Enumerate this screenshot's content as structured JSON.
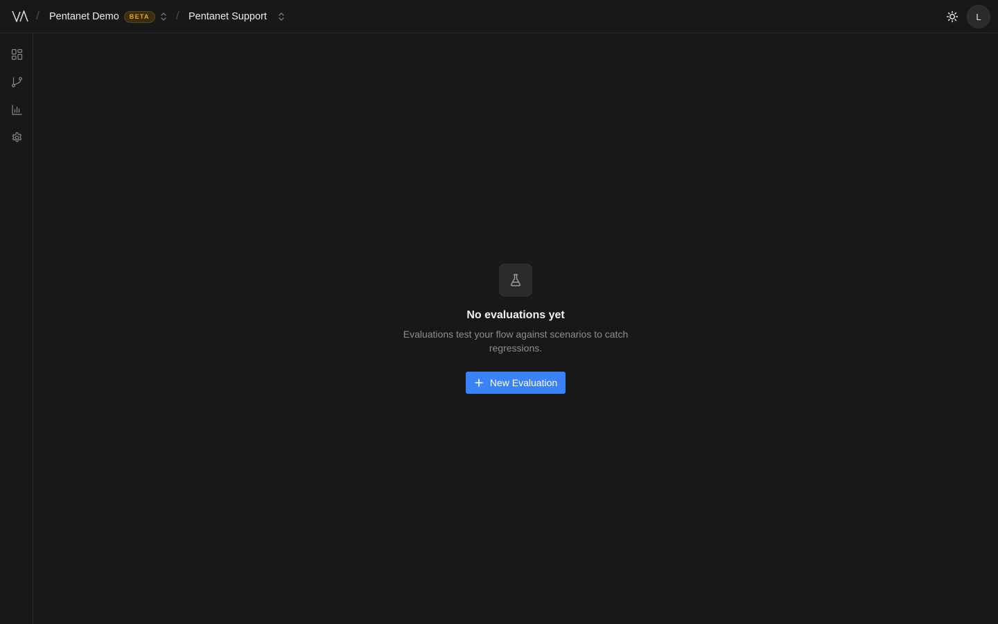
{
  "header": {
    "logo_icon": "va-logo-icon",
    "workspace": {
      "name": "Pentanet Demo",
      "badge": "BETA"
    },
    "project": {
      "name": "Pentanet Support"
    },
    "separator": "/",
    "theme_icon": "sun-icon",
    "avatar_initial": "L"
  },
  "sidebar": {
    "items": [
      {
        "icon": "dashboard-icon"
      },
      {
        "icon": "flow-branch-icon"
      },
      {
        "icon": "bar-chart-icon"
      },
      {
        "icon": "gear-icon"
      }
    ]
  },
  "empty_state": {
    "icon": "flask-icon",
    "title": "No evaluations yet",
    "description": "Evaluations test your flow against scenarios to catch regressions.",
    "button_label": "New Evaluation"
  },
  "colors": {
    "background": "#181818",
    "accent": "#3b82f6",
    "badge_text": "#e5a526"
  }
}
